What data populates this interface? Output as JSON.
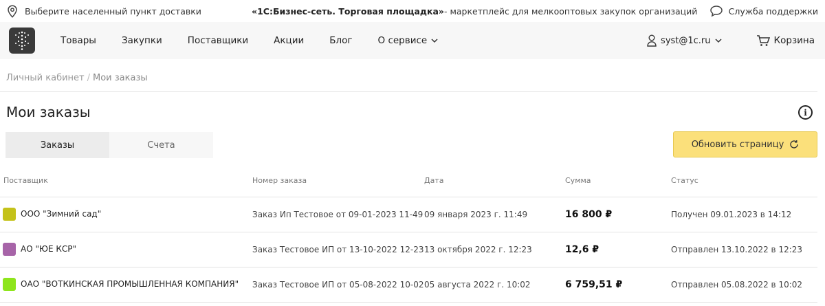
{
  "topbar": {
    "location": "Выберите населенный пункт доставки",
    "brand": "«1С:Бизнес-сеть. Торговая площадка»",
    "tagline": " - маркетплейс для мелкооптовых закупок организаций",
    "support": "Служба поддержки"
  },
  "nav": {
    "items": [
      "Товары",
      "Закупки",
      "Поставщики",
      "Акции",
      "Блог",
      "О сервисе"
    ],
    "user": "syst@1c.ru",
    "cart": "Корзина"
  },
  "breadcrumb": {
    "root": "Личный кабинет",
    "separator": "/",
    "current": "Мои заказы"
  },
  "page": {
    "title": "Мои заказы"
  },
  "tabs": [
    {
      "label": "Заказы",
      "active": true
    },
    {
      "label": "Счета",
      "active": false
    }
  ],
  "refresh_label": "Обновить страницу",
  "table": {
    "headers": [
      "Поставщик",
      "Номер заказа",
      "Дата",
      "Сумма",
      "Статус"
    ],
    "rows": [
      {
        "color": "#c4c21a",
        "supplier": "ООО \"Зимний сад\"",
        "order": "Заказ Ип Тестовое от 09-01-2023 11-49",
        "date": "09 января 2023 г. 11:49",
        "sum": "16 800 ₽",
        "status": "Получен 09.01.2023 в 14:12"
      },
      {
        "color": "#a764a8",
        "supplier": "АО \"ЮЕ КСР\"",
        "order": "Заказ Тестовое ИП от 13-10-2022 12-23",
        "date": "13 октября 2022 г. 12:23",
        "sum": "12,6 ₽",
        "status": "Отправлен 13.10.2022 в 12:23"
      },
      {
        "color": "#8ee51c",
        "supplier": "ОАО \"ВОТКИНСКАЯ ПРОМЫШЛЕННАЯ КОМПАНИЯ\"",
        "order": "Заказ Тестовое ИП от 05-08-2022 10-02",
        "date": "05 августа 2022 г. 10:02",
        "sum": "6 759,51 ₽",
        "status": "Отправлен 05.08.2022 в 10:02"
      }
    ]
  }
}
